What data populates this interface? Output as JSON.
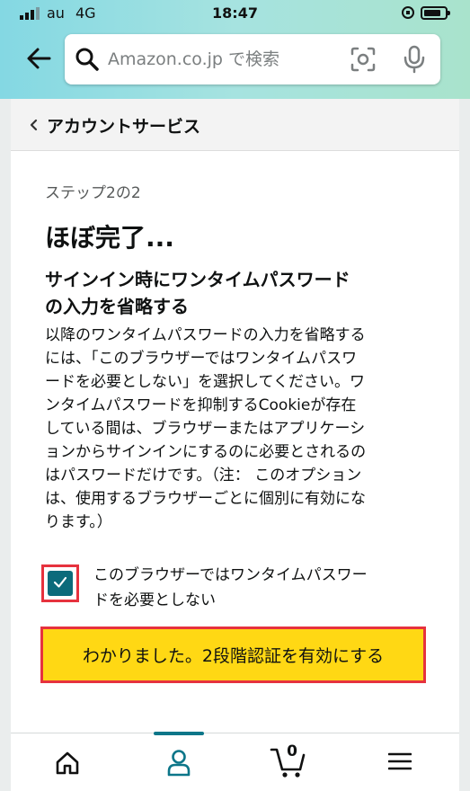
{
  "status_bar": {
    "carrier": "au",
    "network": "4G",
    "time": "18:47"
  },
  "header": {
    "search_placeholder": "Amazon.co.jp で検索"
  },
  "breadcrumb": {
    "label": "アカウントサービス"
  },
  "main": {
    "step": "ステップ2の2",
    "title": "ほぼ完了...",
    "heading_line1": "サインイン時にワンタイムパスワード",
    "heading_line2": "の入力を省略する",
    "body_lines": [
      "以降のワンタイムパスワードの入力を省略する",
      "には、「このブラウザーではワンタイムパスワ",
      "ードを必要としない」を選択してください。ワ",
      "ンタイムパスワードを抑制するCookieが存在",
      "している間は、ブラウザーまたはアプリケーシ",
      "ョンからサインインにするのに必要とされるの",
      "はパスワードだけです。（注： このオプション",
      "は、使用するブラウザーごとに個別に有効にな",
      "ります。）"
    ],
    "checkbox_checked": true,
    "checkbox_label_line1": "このブラウザーではワンタイムパスワー",
    "checkbox_label_line2": "ドを必要としない",
    "button_label": "わかりました。2段階認証を有効にする"
  },
  "bottom_nav": {
    "cart_count": "0",
    "items": [
      "home-icon",
      "account-icon",
      "cart-icon",
      "menu-icon"
    ]
  },
  "colors": {
    "accent_teal": "#0c6b7b",
    "button_yellow": "#ffd814",
    "highlight_red": "#e6323e"
  }
}
